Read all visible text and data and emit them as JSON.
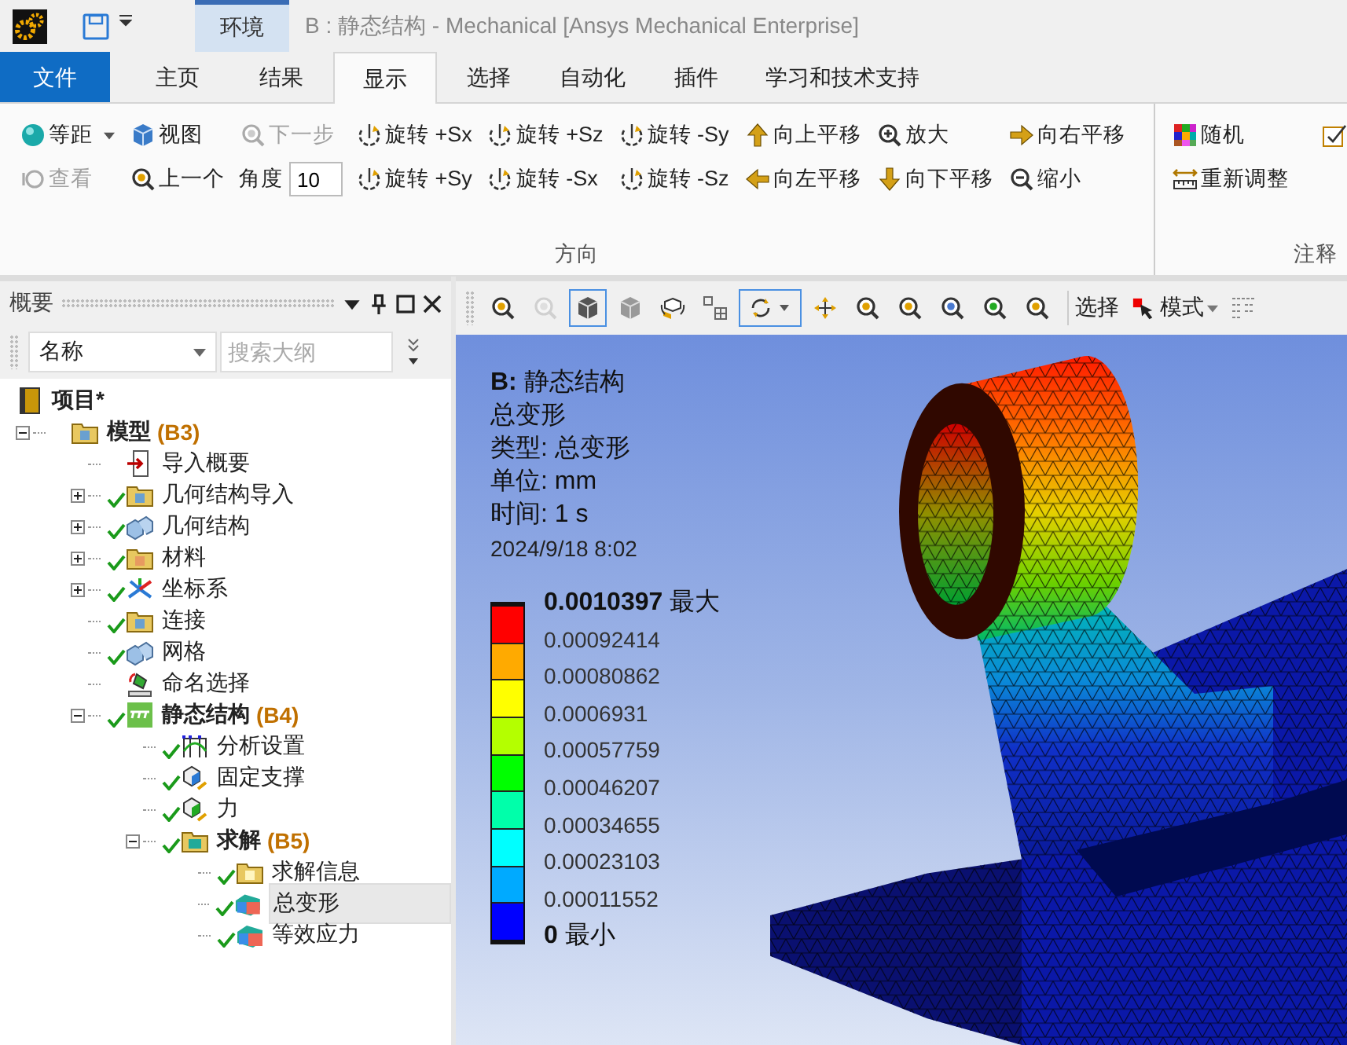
{
  "window": {
    "context_tab": {
      "label": "环境",
      "selected": true
    },
    "title": "B : 静态结构 - Mechanical [Ansys Mechanical Enterprise]"
  },
  "ribbon_tabs": [
    {
      "label": "文件",
      "kind": "file",
      "selected": false
    },
    {
      "label": "主页",
      "kind": "tab",
      "selected": false
    },
    {
      "label": "结果",
      "kind": "tab",
      "selected": false
    },
    {
      "label": "显示",
      "kind": "tab",
      "selected": true
    },
    {
      "label": "选择",
      "kind": "tab",
      "selected": false
    },
    {
      "label": "自动化",
      "kind": "tab",
      "selected": false
    },
    {
      "label": "插件",
      "kind": "tab",
      "selected": false
    },
    {
      "label": "学习和技术支持",
      "kind": "tab",
      "selected": false
    }
  ],
  "ribbon_groups": [
    {
      "label": "方向",
      "columns": [
        [
          {
            "label": "等距",
            "kind": "iso",
            "disabled": false,
            "dropdown": true
          },
          {
            "label": "查看",
            "kind": "look",
            "disabled": true,
            "dropdown": false
          }
        ],
        [
          {
            "label": "视图",
            "kind": "view",
            "disabled": false,
            "dropdown": false
          },
          {
            "label": "上一个",
            "kind": "prev",
            "disabled": false,
            "dropdown": false
          }
        ],
        [
          {
            "label": "下一步",
            "kind": "next",
            "disabled": true,
            "dropdown": false
          },
          {
            "label": "角度",
            "kind": "field",
            "value": "10"
          }
        ],
        [
          {
            "label": "旋转 +Sx",
            "kind": "rotate",
            "disabled": false,
            "dropdown": false
          },
          {
            "label": "旋转 +Sy",
            "kind": "rotate",
            "disabled": false,
            "dropdown": false
          }
        ],
        [
          {
            "label": "旋转 +Sz",
            "kind": "rotate",
            "disabled": false,
            "dropdown": false
          },
          {
            "label": "旋转 -Sx",
            "kind": "rotate",
            "disabled": false,
            "dropdown": false
          }
        ],
        [
          {
            "label": "旋转 -Sy",
            "kind": "rotate",
            "disabled": false,
            "dropdown": false
          },
          {
            "label": "旋转 -Sz",
            "kind": "rotate",
            "disabled": false,
            "dropdown": false
          }
        ],
        [
          {
            "label": "向上平移",
            "kind": "pan-up",
            "disabled": false,
            "dropdown": false
          },
          {
            "label": "向左平移",
            "kind": "pan-left",
            "disabled": false,
            "dropdown": false
          }
        ],
        [
          {
            "label": "放大",
            "kind": "zoom-in",
            "disabled": false,
            "dropdown": false
          },
          {
            "label": "向下平移",
            "kind": "pan-down",
            "disabled": false,
            "dropdown": false
          }
        ],
        [
          {
            "label": "向右平移",
            "kind": "pan-right",
            "disabled": false,
            "dropdown": false
          },
          {
            "label": "缩小",
            "kind": "zoom-out",
            "disabled": false,
            "dropdown": false
          }
        ]
      ]
    },
    {
      "label": "注释",
      "columns": [
        [
          {
            "label": "随机",
            "kind": "random",
            "disabled": false,
            "dropdown": false
          },
          {
            "label": "重新调整",
            "kind": "rescale",
            "disabled": false,
            "dropdown": false
          }
        ]
      ]
    }
  ],
  "outline": {
    "title": "概要",
    "column": "名称",
    "search_placeholder": "搜索大纲",
    "tree": [
      {
        "label": "项目*",
        "kind": "project",
        "bold": true,
        "selected": false,
        "children": [
          {
            "label": "模型",
            "tag": "(B3)",
            "kind": "folder",
            "bold": true,
            "checked": false,
            "selected": false,
            "expanded": true,
            "children": [
              {
                "label": "导入概要",
                "kind": "import",
                "bold": false,
                "checked": false,
                "selected": false
              },
              {
                "label": "几何结构导入",
                "kind": "folder",
                "bold": false,
                "checked": true,
                "selected": false,
                "expanded": false
              },
              {
                "label": "几何结构",
                "kind": "geometry",
                "bold": false,
                "checked": true,
                "selected": false,
                "expanded": false
              },
              {
                "label": "材料",
                "kind": "material",
                "bold": false,
                "checked": true,
                "selected": false,
                "expanded": false
              },
              {
                "label": "坐标系",
                "kind": "coords",
                "bold": false,
                "checked": true,
                "selected": false,
                "expanded": false
              },
              {
                "label": "连接",
                "kind": "folder",
                "bold": false,
                "checked": true,
                "selected": false
              },
              {
                "label": "网格",
                "kind": "geometry",
                "bold": false,
                "checked": true,
                "selected": false
              },
              {
                "label": "命名选择",
                "kind": "named",
                "bold": false,
                "checked": false,
                "selected": false
              },
              {
                "label": "静态结构",
                "tag": "(B4)",
                "kind": "analysis",
                "bold": true,
                "checked": true,
                "selected": false,
                "expanded": true,
                "children": [
                  {
                    "label": "分析设置",
                    "kind": "settings",
                    "bold": false,
                    "checked": true,
                    "selected": false
                  },
                  {
                    "label": "固定支撑",
                    "kind": "support",
                    "bold": false,
                    "checked": true,
                    "selected": false
                  },
                  {
                    "label": "力",
                    "kind": "force",
                    "bold": false,
                    "checked": true,
                    "selected": false
                  },
                  {
                    "label": "求解",
                    "tag": "(B5)",
                    "kind": "solution",
                    "bold": true,
                    "checked": true,
                    "selected": false,
                    "expanded": true,
                    "children": [
                      {
                        "label": "求解信息",
                        "kind": "info",
                        "bold": false,
                        "checked": true,
                        "selected": false
                      },
                      {
                        "label": "总变形",
                        "kind": "result",
                        "bold": false,
                        "checked": true,
                        "selected": true
                      },
                      {
                        "label": "等效应力",
                        "kind": "result",
                        "bold": false,
                        "checked": true,
                        "selected": false
                      }
                    ]
                  }
                ]
              }
            ]
          }
        ]
      }
    ]
  },
  "viewport_toolbar": {
    "tools": [
      {
        "kind": "zoom-prev",
        "selected": false,
        "disabled": false
      },
      {
        "kind": "zoom-next",
        "selected": false,
        "disabled": true
      },
      {
        "kind": "cube",
        "selected": true,
        "disabled": false
      },
      {
        "kind": "solid",
        "selected": false,
        "disabled": false
      },
      {
        "kind": "parts",
        "selected": false,
        "disabled": false
      },
      {
        "kind": "split",
        "selected": false,
        "disabled": false
      },
      {
        "kind": "rotate",
        "selected": true,
        "disabled": false
      },
      {
        "kind": "pan",
        "selected": false,
        "disabled": false
      },
      {
        "kind": "zoom-fit",
        "selected": false,
        "disabled": false
      },
      {
        "kind": "zoom-in",
        "selected": false,
        "disabled": false
      },
      {
        "kind": "zoom-iso",
        "selected": false,
        "disabled": false
      },
      {
        "kind": "zoom-sel",
        "selected": false,
        "disabled": false
      },
      {
        "kind": "zoom-fit",
        "selected": false,
        "disabled": false
      }
    ],
    "select_label": "选择",
    "mode_label": "模式"
  },
  "viewport": {
    "heading": "**B:** 静态结构",
    "lines": [
      "总变形",
      "类型: 总变形",
      "单位: mm",
      "时间: 1 s"
    ],
    "date": "2024/9/18 8:02",
    "legend": {
      "labels": [
        "**0.0010397** 最大",
        "0.00092414",
        "0.00080862",
        "0.0006931",
        "0.00057759",
        "0.00046207",
        "0.00034655",
        "0.00023103",
        "0.00011552",
        "**0** 最小"
      ],
      "bands": [
        {
          "color": "#ff0000"
        },
        {
          "color": "#ffaa00"
        },
        {
          "color": "#ffff00"
        },
        {
          "color": "#b4ff00"
        },
        {
          "color": "#00ff00"
        },
        {
          "color": "#00ffaa"
        },
        {
          "color": "#00ffff"
        },
        {
          "color": "#00aaff"
        },
        {
          "color": "#0000ff"
        }
      ]
    }
  }
}
